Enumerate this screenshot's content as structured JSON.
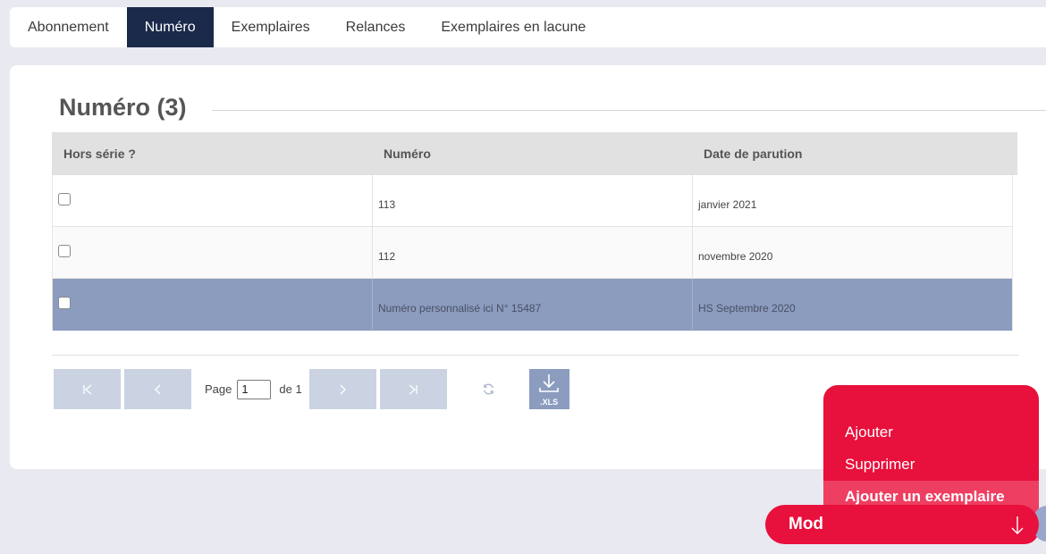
{
  "tabs": [
    {
      "label": "Abonnement",
      "active": false
    },
    {
      "label": "Numéro",
      "active": true
    },
    {
      "label": "Exemplaires",
      "active": false
    },
    {
      "label": "Relances",
      "active": false
    },
    {
      "label": "Exemplaires en lacune",
      "active": false
    }
  ],
  "section": {
    "title": "Numéro (3)"
  },
  "grid": {
    "columns": [
      "Hors série ?",
      "Numéro",
      "Date de parution"
    ],
    "rows": [
      {
        "hors_serie": false,
        "numero": "113",
        "date": "janvier 2021",
        "selected": false
      },
      {
        "hors_serie": false,
        "numero": "112",
        "date": "novembre 2020",
        "selected": false
      },
      {
        "hors_serie": false,
        "numero": "Numéro personnalisé ici N° 15487",
        "date": "HS Septembre 2020",
        "selected": true
      }
    ]
  },
  "pager": {
    "page_label": "Page",
    "current_page": "1",
    "of_label": "de 1",
    "export_label": ".XLS"
  },
  "actions": {
    "menu": [
      {
        "label": "Ajouter"
      },
      {
        "label": "Supprimer"
      },
      {
        "label": "Ajouter un exemplaire"
      }
    ],
    "button_label": "Modifier"
  },
  "colors": {
    "active_tab": "#1b2a4a",
    "selected_row": "#8b9cbf",
    "pager_button": "#cbd3e2",
    "action_red": "#e8103c"
  }
}
